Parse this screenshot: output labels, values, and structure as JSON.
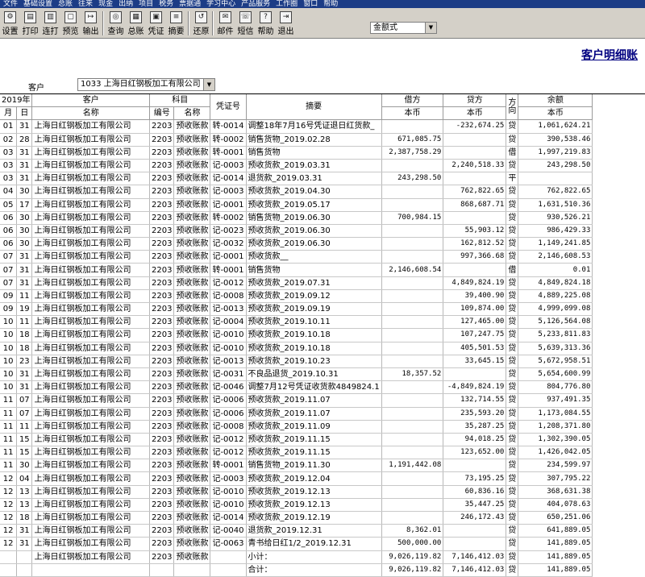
{
  "menu": [
    "文件",
    "基础设置",
    "总账",
    "往来",
    "现金",
    "出纳",
    "项目",
    "税务",
    "票据通",
    "学习中心",
    "产品服务",
    "工作圈",
    "窗口",
    "帮助"
  ],
  "toolbar": {
    "buttons": [
      {
        "label": "设置",
        "icon": "settings-icon"
      },
      {
        "label": "打印",
        "icon": "print-icon"
      },
      {
        "label": "连打",
        "icon": "continuous-print-icon"
      },
      {
        "label": "预览",
        "icon": "preview-icon"
      },
      {
        "label": "输出",
        "icon": "export-icon"
      },
      {
        "label": "查询",
        "icon": "binoculars-icon"
      },
      {
        "label": "总账",
        "icon": "ledger-book-icon"
      },
      {
        "label": "凭证",
        "icon": "voucher-icon"
      },
      {
        "label": "摘要",
        "icon": "summary-icon"
      },
      {
        "label": "还原",
        "icon": "restore-icon"
      },
      {
        "label": "邮件",
        "icon": "mail-icon"
      },
      {
        "label": "短信",
        "icon": "sms-icon"
      },
      {
        "label": "帮助",
        "icon": "help-icon"
      },
      {
        "label": "退出",
        "icon": "exit-icon"
      }
    ],
    "format_value": "金额式"
  },
  "report_title": "客户明细账",
  "customer": {
    "label": "客户",
    "value": "1033  上海日红钢板加工有限公司"
  },
  "headers": {
    "year": "2019年",
    "month": "月",
    "day": "日",
    "customer_group": "客户",
    "customer_name": "名称",
    "subject_group": "科目",
    "subject_code": "编号",
    "subject_name": "名称",
    "voucher": "凭证号",
    "summary": "摘要",
    "debit": "借方",
    "debit_sub": "本币",
    "credit": "贷方",
    "credit_sub": "本币",
    "direction": "方向",
    "balance": "余额",
    "balance_sub": "本币"
  },
  "rows": [
    {
      "m": "01",
      "d": "31",
      "name": "上海日红钢板加工有限公司",
      "code": "2203",
      "subject": "预收账款",
      "voucher": "转-0014",
      "summary": "调整18年7月16号凭证退日红货款_",
      "debit": "",
      "credit": "-232,674.25",
      "dir": "贷",
      "balance": "1,061,624.21"
    },
    {
      "m": "02",
      "d": "28",
      "name": "上海日红钢板加工有限公司",
      "code": "2203",
      "subject": "预收账款",
      "voucher": "转-0002",
      "summary": "销售货物_2019.02.28",
      "debit": "671,085.75",
      "credit": "",
      "dir": "贷",
      "balance": "390,538.46"
    },
    {
      "m": "03",
      "d": "31",
      "name": "上海日红钢板加工有限公司",
      "code": "2203",
      "subject": "预收账款",
      "voucher": "转-0001",
      "summary": "销售货物",
      "debit": "2,387,758.29",
      "credit": "",
      "dir": "借",
      "balance": "1,997,219.83"
    },
    {
      "m": "03",
      "d": "31",
      "name": "上海日红钢板加工有限公司",
      "code": "2203",
      "subject": "预收账款",
      "voucher": "记-0003",
      "summary": "预收货款_2019.03.31",
      "debit": "",
      "credit": "2,240,518.33",
      "dir": "贷",
      "balance": "243,298.50"
    },
    {
      "m": "03",
      "d": "31",
      "name": "上海日红钢板加工有限公司",
      "code": "2203",
      "subject": "预收账款",
      "voucher": "记-0014",
      "summary": "退货款_2019.03.31",
      "debit": "243,298.50",
      "credit": "",
      "dir": "平",
      "balance": ""
    },
    {
      "m": "04",
      "d": "30",
      "name": "上海日红钢板加工有限公司",
      "code": "2203",
      "subject": "预收账款",
      "voucher": "记-0003",
      "summary": "预收货款_2019.04.30",
      "debit": "",
      "credit": "762,822.65",
      "dir": "贷",
      "balance": "762,822.65"
    },
    {
      "m": "05",
      "d": "17",
      "name": "上海日红钢板加工有限公司",
      "code": "2203",
      "subject": "预收账款",
      "voucher": "记-0001",
      "summary": "预收货款_2019.05.17",
      "debit": "",
      "credit": "868,687.71",
      "dir": "贷",
      "balance": "1,631,510.36"
    },
    {
      "m": "06",
      "d": "30",
      "name": "上海日红钢板加工有限公司",
      "code": "2203",
      "subject": "预收账款",
      "voucher": "转-0002",
      "summary": "销售货物_2019.06.30",
      "debit": "700,984.15",
      "credit": "",
      "dir": "贷",
      "balance": "930,526.21"
    },
    {
      "m": "06",
      "d": "30",
      "name": "上海日红钢板加工有限公司",
      "code": "2203",
      "subject": "预收账款",
      "voucher": "记-0023",
      "summary": "预收货款_2019.06.30",
      "debit": "",
      "credit": "55,903.12",
      "dir": "贷",
      "balance": "986,429.33"
    },
    {
      "m": "06",
      "d": "30",
      "name": "上海日红钢板加工有限公司",
      "code": "2203",
      "subject": "预收账款",
      "voucher": "记-0032",
      "summary": "预收货款_2019.06.30",
      "debit": "",
      "credit": "162,812.52",
      "dir": "贷",
      "balance": "1,149,241.85"
    },
    {
      "m": "07",
      "d": "31",
      "name": "上海日红钢板加工有限公司",
      "code": "2203",
      "subject": "预收账款",
      "voucher": "记-0001",
      "summary": "预收货款__",
      "debit": "",
      "credit": "997,366.68",
      "dir": "贷",
      "balance": "2,146,608.53"
    },
    {
      "m": "07",
      "d": "31",
      "name": "上海日红钢板加工有限公司",
      "code": "2203",
      "subject": "预收账款",
      "voucher": "转-0001",
      "summary": "销售货物",
      "debit": "2,146,608.54",
      "credit": "",
      "dir": "借",
      "balance": "0.01"
    },
    {
      "m": "07",
      "d": "31",
      "name": "上海日红钢板加工有限公司",
      "code": "2203",
      "subject": "预收账款",
      "voucher": "记-0012",
      "summary": "预收货款_2019.07.31",
      "debit": "",
      "credit": "4,849,824.19",
      "dir": "贷",
      "balance": "4,849,824.18"
    },
    {
      "m": "09",
      "d": "11",
      "name": "上海日红钢板加工有限公司",
      "code": "2203",
      "subject": "预收账款",
      "voucher": "记-0008",
      "summary": "预收货款_2019.09.12",
      "debit": "",
      "credit": "39,400.90",
      "dir": "贷",
      "balance": "4,889,225.08"
    },
    {
      "m": "09",
      "d": "19",
      "name": "上海日红钢板加工有限公司",
      "code": "2203",
      "subject": "预收账款",
      "voucher": "记-0013",
      "summary": "预收货款_2019.09.19",
      "debit": "",
      "credit": "109,874.00",
      "dir": "贷",
      "balance": "4,999,099.08"
    },
    {
      "m": "10",
      "d": "11",
      "name": "上海日红钢板加工有限公司",
      "code": "2203",
      "subject": "预收账款",
      "voucher": "记-0004",
      "summary": "预收货款_2019.10.11",
      "debit": "",
      "credit": "127,465.00",
      "dir": "贷",
      "balance": "5,126,564.08"
    },
    {
      "m": "10",
      "d": "18",
      "name": "上海日红钢板加工有限公司",
      "code": "2203",
      "subject": "预收账款",
      "voucher": "记-0010",
      "summary": "预收货款_2019.10.18",
      "debit": "",
      "credit": "107,247.75",
      "dir": "贷",
      "balance": "5,233,811.83"
    },
    {
      "m": "10",
      "d": "18",
      "name": "上海日红钢板加工有限公司",
      "code": "2203",
      "subject": "预收账款",
      "voucher": "记-0010",
      "summary": "预收货款_2019.10.18",
      "debit": "",
      "credit": "405,501.53",
      "dir": "贷",
      "balance": "5,639,313.36"
    },
    {
      "m": "10",
      "d": "23",
      "name": "上海日红钢板加工有限公司",
      "code": "2203",
      "subject": "预收账款",
      "voucher": "记-0013",
      "summary": "预收货款_2019.10.23",
      "debit": "",
      "credit": "33,645.15",
      "dir": "贷",
      "balance": "5,672,958.51"
    },
    {
      "m": "10",
      "d": "31",
      "name": "上海日红钢板加工有限公司",
      "code": "2203",
      "subject": "预收账款",
      "voucher": "记-0031",
      "summary": "不良品退货_2019.10.31",
      "debit": "18,357.52",
      "credit": "",
      "dir": "贷",
      "balance": "5,654,600.99"
    },
    {
      "m": "10",
      "d": "31",
      "name": "上海日红钢板加工有限公司",
      "code": "2203",
      "subject": "预收账款",
      "voucher": "记-0046",
      "summary": "调整7月12号凭证收货款4849824.1",
      "debit": "",
      "credit": "-4,849,824.19",
      "dir": "贷",
      "balance": "804,776.80"
    },
    {
      "m": "11",
      "d": "07",
      "name": "上海日红钢板加工有限公司",
      "code": "2203",
      "subject": "预收账款",
      "voucher": "记-0006",
      "summary": "预收货款_2019.11.07",
      "debit": "",
      "credit": "132,714.55",
      "dir": "贷",
      "balance": "937,491.35"
    },
    {
      "m": "11",
      "d": "07",
      "name": "上海日红钢板加工有限公司",
      "code": "2203",
      "subject": "预收账款",
      "voucher": "记-0006",
      "summary": "预收货款_2019.11.07",
      "debit": "",
      "credit": "235,593.20",
      "dir": "贷",
      "balance": "1,173,084.55"
    },
    {
      "m": "11",
      "d": "11",
      "name": "上海日红钢板加工有限公司",
      "code": "2203",
      "subject": "预收账款",
      "voucher": "记-0008",
      "summary": "预收货款_2019.11.09",
      "debit": "",
      "credit": "35,287.25",
      "dir": "贷",
      "balance": "1,208,371.80"
    },
    {
      "m": "11",
      "d": "15",
      "name": "上海日红钢板加工有限公司",
      "code": "2203",
      "subject": "预收账款",
      "voucher": "记-0012",
      "summary": "预收货款_2019.11.15",
      "debit": "",
      "credit": "94,018.25",
      "dir": "贷",
      "balance": "1,302,390.05"
    },
    {
      "m": "11",
      "d": "15",
      "name": "上海日红钢板加工有限公司",
      "code": "2203",
      "subject": "预收账款",
      "voucher": "记-0012",
      "summary": "预收货款_2019.11.15",
      "debit": "",
      "credit": "123,652.00",
      "dir": "贷",
      "balance": "1,426,042.05"
    },
    {
      "m": "11",
      "d": "30",
      "name": "上海日红钢板加工有限公司",
      "code": "2203",
      "subject": "预收账款",
      "voucher": "转-0001",
      "summary": "销售货物_2019.11.30",
      "debit": "1,191,442.08",
      "credit": "",
      "dir": "贷",
      "balance": "234,599.97"
    },
    {
      "m": "12",
      "d": "04",
      "name": "上海日红钢板加工有限公司",
      "code": "2203",
      "subject": "预收账款",
      "voucher": "记-0003",
      "summary": "预收货款_2019.12.04",
      "debit": "",
      "credit": "73,195.25",
      "dir": "贷",
      "balance": "307,795.22"
    },
    {
      "m": "12",
      "d": "13",
      "name": "上海日红钢板加工有限公司",
      "code": "2203",
      "subject": "预收账款",
      "voucher": "记-0010",
      "summary": "预收货款_2019.12.13",
      "debit": "",
      "credit": "60,836.16",
      "dir": "贷",
      "balance": "368,631.38"
    },
    {
      "m": "12",
      "d": "13",
      "name": "上海日红钢板加工有限公司",
      "code": "2203",
      "subject": "预收账款",
      "voucher": "记-0010",
      "summary": "预收货款_2019.12.13",
      "debit": "",
      "credit": "35,447.25",
      "dir": "贷",
      "balance": "404,078.63"
    },
    {
      "m": "12",
      "d": "18",
      "name": "上海日红钢板加工有限公司",
      "code": "2203",
      "subject": "预收账款",
      "voucher": "记-0014",
      "summary": "预收货款_2019.12.19",
      "debit": "",
      "credit": "246,172.43",
      "dir": "贷",
      "balance": "650,251.06"
    },
    {
      "m": "12",
      "d": "31",
      "name": "上海日红钢板加工有限公司",
      "code": "2203",
      "subject": "预收账款",
      "voucher": "记-0040",
      "summary": "退货款_2019.12.31",
      "debit": "8,362.01",
      "credit": "",
      "dir": "贷",
      "balance": "641,889.05"
    },
    {
      "m": "12",
      "d": "31",
      "name": "上海日红钢板加工有限公司",
      "code": "2203",
      "subject": "预收账款",
      "voucher": "记-0063",
      "summary": "青书给日红1/2_2019.12.31",
      "debit": "500,000.00",
      "credit": "",
      "dir": "贷",
      "balance": "141,889.05"
    },
    {
      "m": "",
      "d": "",
      "name": "上海日红钢板加工有限公司",
      "code": "2203",
      "subject": "预收账款",
      "voucher": "",
      "summary": "小计：",
      "debit": "9,026,119.82",
      "credit": "7,146,412.03",
      "dir": "贷",
      "balance": "141,889.05"
    },
    {
      "m": "",
      "d": "",
      "name": "",
      "code": "",
      "subject": "",
      "voucher": "",
      "summary": "合计：",
      "debit": "9,026,119.82",
      "credit": "7,146,412.03",
      "dir": "贷",
      "balance": "141,889.05"
    }
  ]
}
